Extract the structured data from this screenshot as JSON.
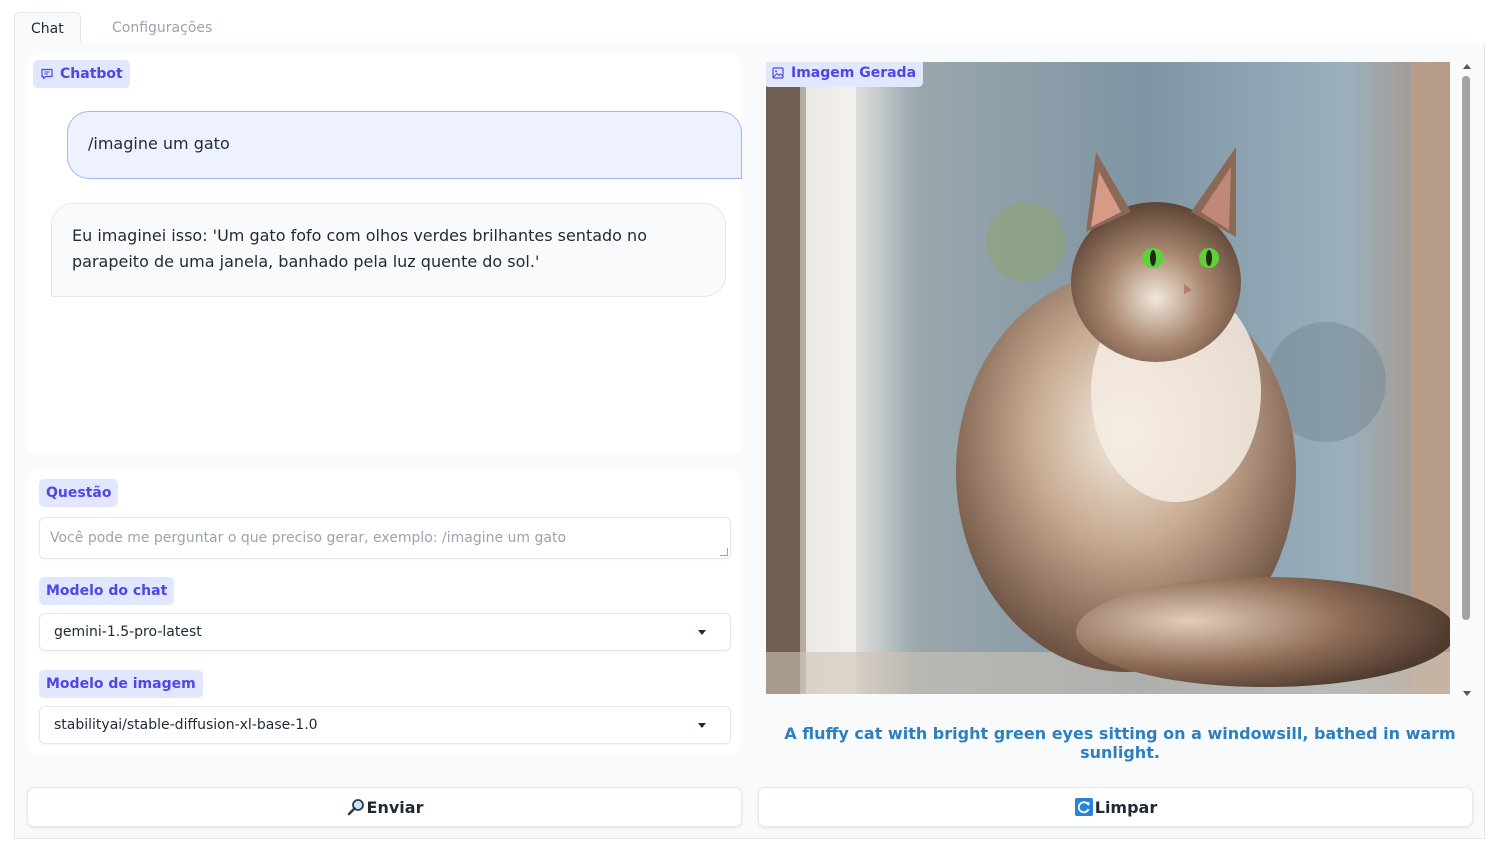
{
  "tabs": [
    {
      "label": "Chat"
    },
    {
      "label": "Configurações"
    }
  ],
  "chatbot": {
    "label": "Chatbot",
    "messages": [
      {
        "role": "user",
        "text": "/imagine um gato"
      },
      {
        "role": "bot",
        "text": "Eu imaginei isso: 'Um gato fofo com olhos verdes brilhantes sentado no parapeito de uma janela, banhado pela luz quente do sol.'"
      }
    ]
  },
  "question": {
    "label": "Questão",
    "placeholder": "Você pode me perguntar o que preciso gerar, exemplo: /imagine um gato"
  },
  "chat_model": {
    "label": "Modelo do chat",
    "value": "gemini-1.5-pro-latest"
  },
  "image_model": {
    "label": "Modelo de imagem",
    "value": "stabilityai/stable-diffusion-xl-base-1.0"
  },
  "generated_image": {
    "label": "Imagem Gerada",
    "caption": "A fluffy cat with bright green eyes sitting on a windowsill, bathed in warm sunlight."
  },
  "buttons": {
    "send": {
      "label": "Enviar",
      "icon": "magnifier-icon"
    },
    "clear": {
      "label": "Limpar",
      "icon": "refresh-icon"
    }
  },
  "colors": {
    "accent": "#4f46e5",
    "chip_bg": "#e0e7ff",
    "caption": "#2e7fbf"
  }
}
